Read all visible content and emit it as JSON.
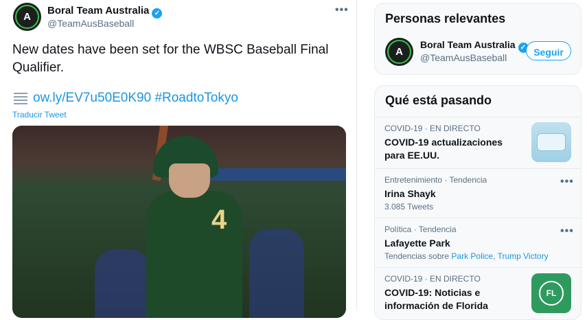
{
  "tweet": {
    "author_name": "Boral Team Australia",
    "author_handle": "@TeamAusBaseball",
    "avatar_glyph": "A",
    "verified_glyph": "✓",
    "more_glyph": "•••",
    "text": "New dates have been set for the WBSC Baseball Final Qualifier.",
    "link_text": "ow.ly/EV7u50E0K90 #RoadtoTokyo",
    "translate_label": "Traducir Tweet",
    "media_number": "4"
  },
  "sidebar": {
    "relevant": {
      "title": "Personas relevantes",
      "name": "Boral Team Australia",
      "handle": "@TeamAusBaseball",
      "follow_label": "Seguir"
    },
    "trends": {
      "title": "Qué está pasando",
      "items": [
        {
          "meta": "COVID-19 · EN DIRECTO",
          "title": "COVID-19 actualizaciones para EE.UU.",
          "image": "mask-image"
        },
        {
          "meta": "Entretenimiento · Tendencia",
          "title": "Irina Shayk",
          "sub": "3.085 Tweets"
        },
        {
          "meta": "Política · Tendencia",
          "title": "Lafayette Park",
          "sub_prefix": "Tendencias sobre",
          "sub_link1": "Park Police",
          "sub_sep": ",",
          "sub_link2": "Trump Victory"
        },
        {
          "meta": "COVID-19 · EN DIRECTO",
          "title": "COVID-19: Noticias e información de Florida",
          "image": "florida-image",
          "image_text": "FL"
        }
      ]
    }
  },
  "colors": {
    "accent": "#1da1f2",
    "link": "#1b95e0",
    "secondary_text": "#5b7083",
    "avatar_ring": "#3cc24a"
  }
}
